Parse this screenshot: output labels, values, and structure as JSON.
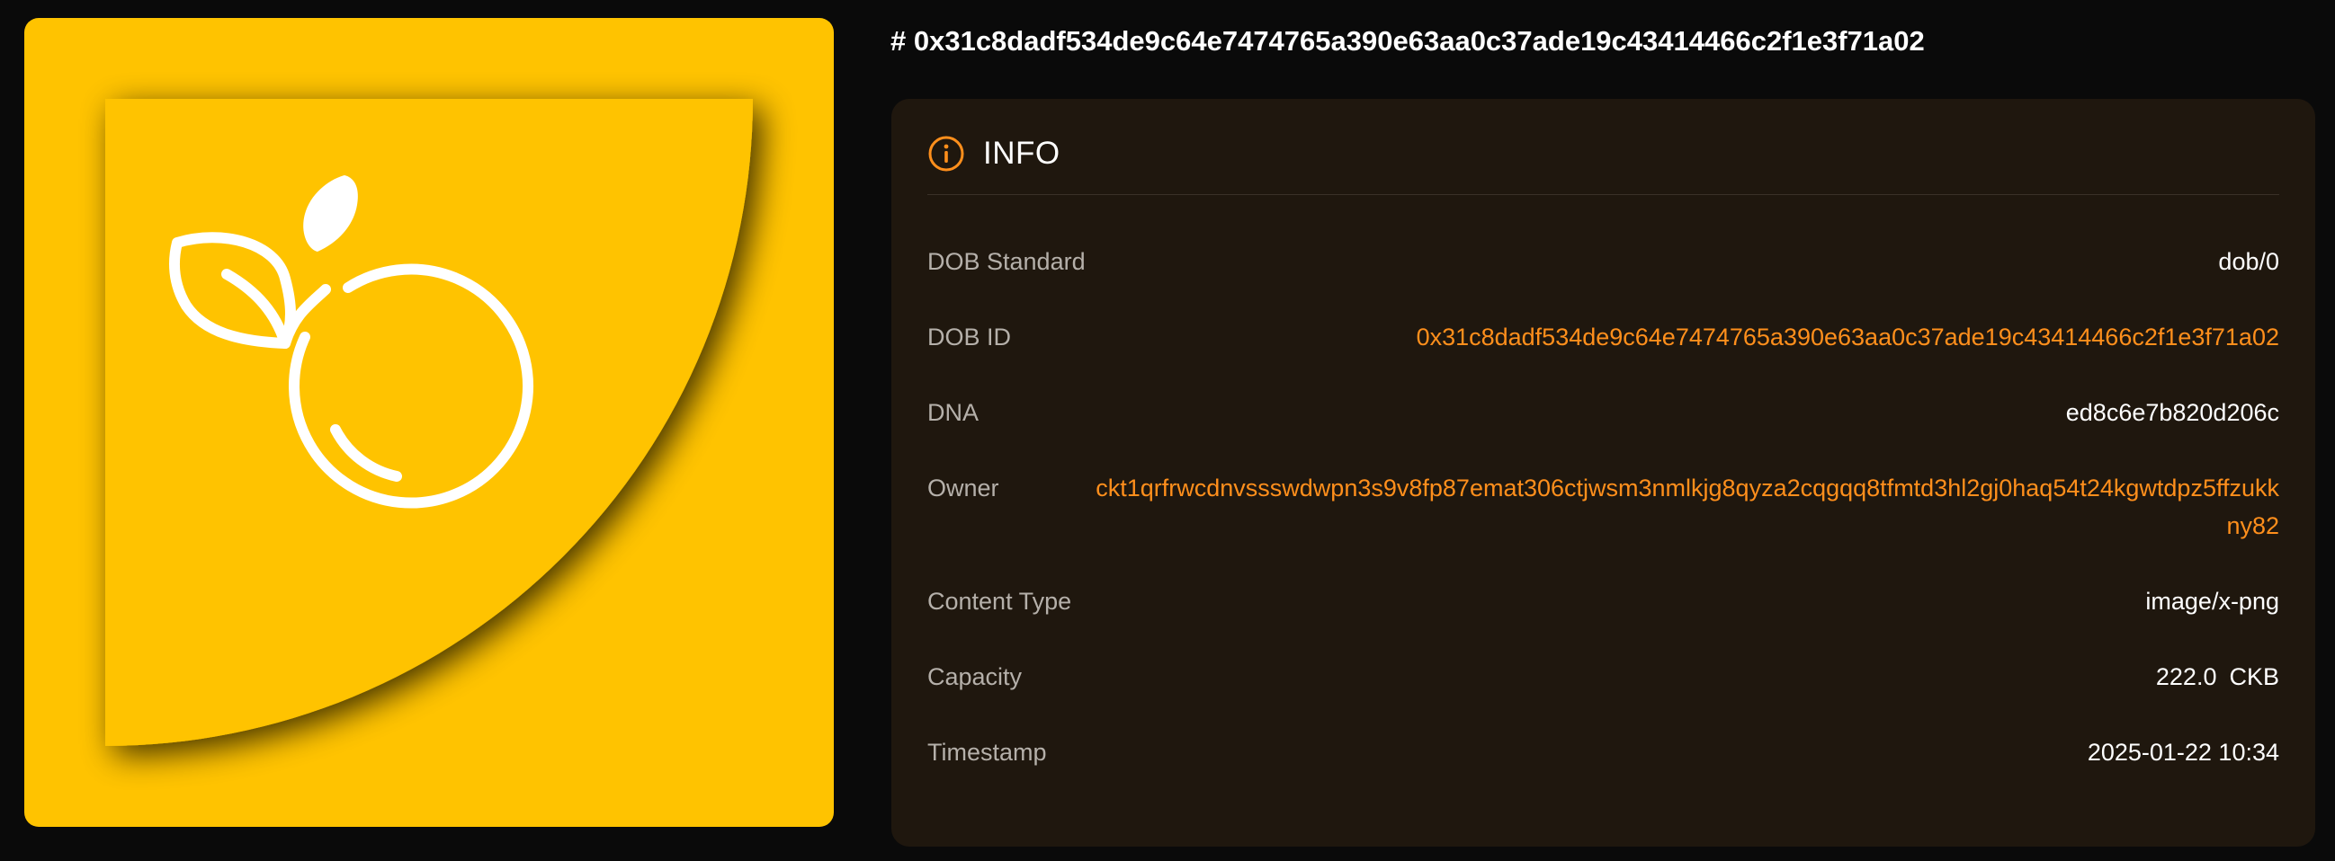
{
  "title": "# 0x31c8dadf534de9c64e7474765a390e63aa0c37ade19c43414466c2f1e3f71a02",
  "artwork": {
    "background_color": "#ffc300",
    "icon": "orange-fruit-icon"
  },
  "info": {
    "heading": "INFO",
    "icon": "info-circle-icon",
    "accent_color": "#ff8f1c",
    "rows": {
      "dob_standard": {
        "label": "DOB Standard",
        "value": "dob/0"
      },
      "dob_id": {
        "label": "DOB ID",
        "value": "0x31c8dadf534de9c64e7474765a390e63aa0c37ade19c43414466c2f1e3f71a02"
      },
      "dna": {
        "label": "DNA",
        "value": "ed8c6e7b820d206c"
      },
      "owner": {
        "label": "Owner",
        "value": "ckt1qrfrwcdnvssswdwpn3s9v8fp87emat306ctjwsm3nmlkjg8qyza2cqgqq8tfmtd3hl2gj0haq54t24kgwtdpz5ffzukkny82"
      },
      "content_type": {
        "label": "Content Type",
        "value": "image/x-png"
      },
      "capacity": {
        "label": "Capacity",
        "value": "222.0",
        "unit": "CKB"
      },
      "timestamp": {
        "label": "Timestamp",
        "value": "2025-01-22 10:34"
      }
    }
  }
}
